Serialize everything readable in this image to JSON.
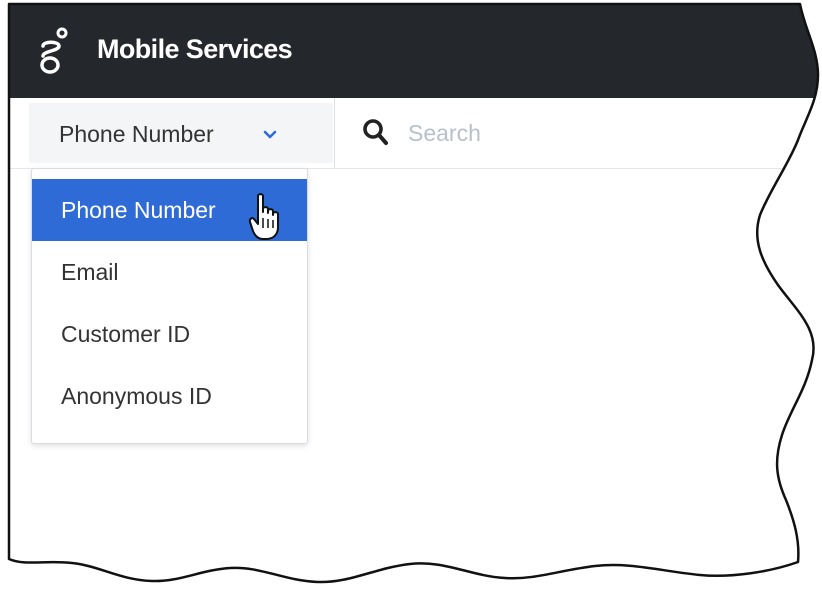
{
  "app": {
    "title": "Mobile Services"
  },
  "toolbar": {
    "search_type": {
      "selected": "Phone Number",
      "options": [
        "Phone Number",
        "Email",
        "Customer ID",
        "Anonymous ID"
      ]
    },
    "search": {
      "placeholder": "Search",
      "value": ""
    }
  },
  "icons": {
    "logo": "genesys-logo-icon",
    "chevron": "chevron-down-icon",
    "search": "search-icon",
    "cursor": "hand-pointer-cursor-icon"
  },
  "colors": {
    "header_bg": "#24282d",
    "accent": "#2e6bd6",
    "select_bg": "#f4f5f6"
  }
}
